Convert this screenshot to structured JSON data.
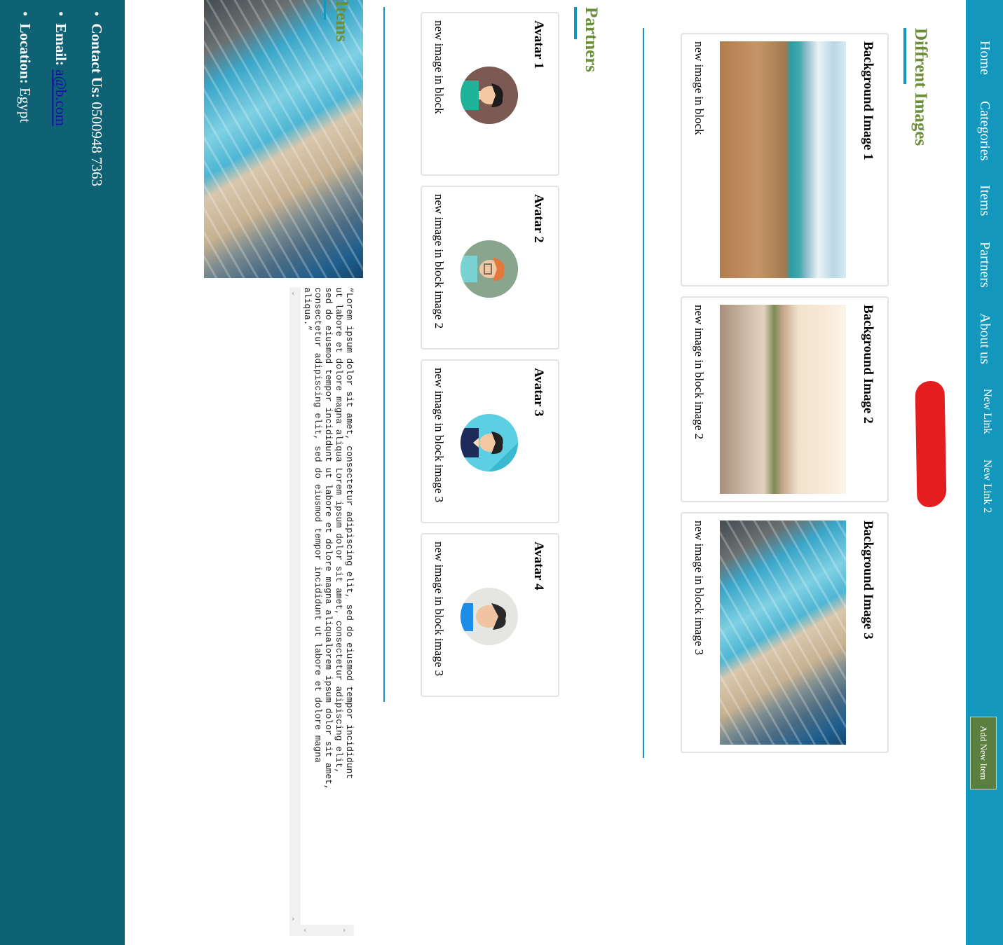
{
  "nav": {
    "links": [
      "Home",
      "Categories",
      "Items",
      "Partners",
      "About us",
      "New Link",
      "New Link 2"
    ],
    "add_button": "Add New Item"
  },
  "images_section": {
    "title": "Diffrent Images",
    "cards": [
      {
        "title": "Background Image 1",
        "text": "new image in block"
      },
      {
        "title": "Background Image 2",
        "text": "new image in block image 2"
      },
      {
        "title": "Background Image 3",
        "text": "new image in block image 3"
      }
    ]
  },
  "partners_section": {
    "title": "Partners",
    "cards": [
      {
        "title": "Avatar 1",
        "text": "new image in block"
      },
      {
        "title": "Avatar 2",
        "text": "new image in block image 2"
      },
      {
        "title": "Avatar 3",
        "text": "new image in block image 3"
      },
      {
        "title": "Avatar 4",
        "text": "new image in block image 3"
      }
    ]
  },
  "items_section": {
    "title": "Items",
    "quote": "“Lorem ipsum dolor sit amet, consectetur adipiscing elit, sed do eiusmod tempor incididunt ut labore et dolore magna aliqua Lorem ipsum dolor sit amet, consectetur adipiscing elit, sed do eiusmod tempor incididunt ut labore et dolore magna aliqualorem ipsum dolor sit amet, consectetur adipiscing elit, sed do eiusmod tempor incididunt ut labore et dolore magna aliqua.”"
  },
  "footer": {
    "contact_label": "Contact Us:",
    "contact_value": "0500948 7363",
    "email_label": "Email:",
    "email_value": "a@b.com",
    "location_label": "Location:",
    "location_value": "Egypt"
  },
  "colors": {
    "nav_bg": "#1497bd",
    "footer_bg": "#0f6174",
    "section_title": "#6b8e3a",
    "button_bg": "#5b7f3e"
  }
}
